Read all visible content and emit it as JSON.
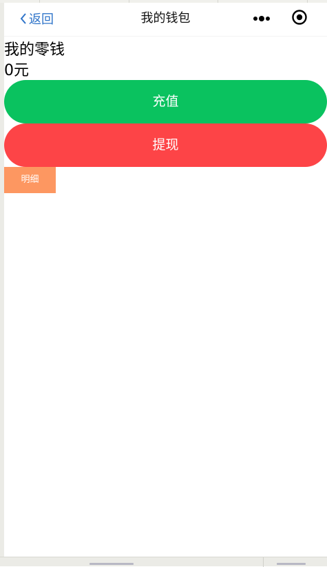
{
  "navbar": {
    "back_label": "返回",
    "title": "我的钱包",
    "icons": {
      "back": "chevron-left-icon",
      "more": "more-dots-icon",
      "capsule": "target-icon"
    },
    "accent_color": "#2f74c9"
  },
  "wallet": {
    "label": "我的零钱",
    "balance": "0元"
  },
  "actions": {
    "recharge_label": "充值",
    "recharge_color": "#0ac25f",
    "withdraw_label": "提现",
    "withdraw_color": "#fd4447",
    "detail_label": "明细",
    "detail_color": "#fd9761"
  }
}
